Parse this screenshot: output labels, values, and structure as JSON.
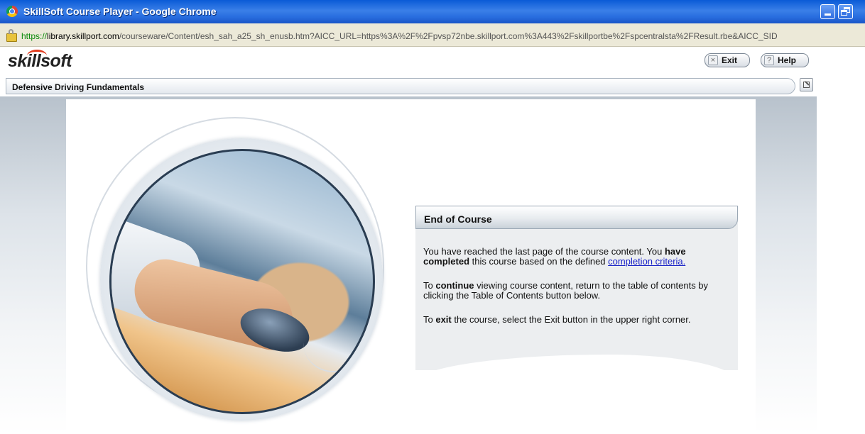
{
  "window": {
    "title": "SkillSoft Course Player - Google Chrome"
  },
  "address_bar": {
    "scheme": "https://",
    "host": "library.skillport.com",
    "path": "/courseware/Content/esh_sah_a25_sh_enusb.htm?AICC_URL=https%3A%2F%2Fpvsp72nbe.skillport.com%3A443%2Fskillportbe%2Fspcentralsta%2FResult.rbe&AICC_SID"
  },
  "header": {
    "logo_text": "skillsoft",
    "exit_label": "Exit",
    "help_label": "Help",
    "exit_icon": "×",
    "help_icon": "?"
  },
  "course": {
    "title": "Defensive Driving Fundamentals"
  },
  "panel": {
    "title": "End of Course",
    "p1_a": "You have reached the last page of the course content. You ",
    "p1_b": "have completed",
    "p1_c": " this course based on the defined ",
    "p1_link": "completion criteria.",
    "p2_a": "To ",
    "p2_b": "continue",
    "p2_c": " viewing course content, return to the table of contents by clicking the Table of Contents button below.",
    "p3_a": "To ",
    "p3_b": "exit",
    "p3_c": " the course, select the Exit button in the upper right corner."
  },
  "colors": {
    "titlebar": "#2a6fe0",
    "link": "#1a23c8",
    "logo_accent": "#e23b1e"
  }
}
